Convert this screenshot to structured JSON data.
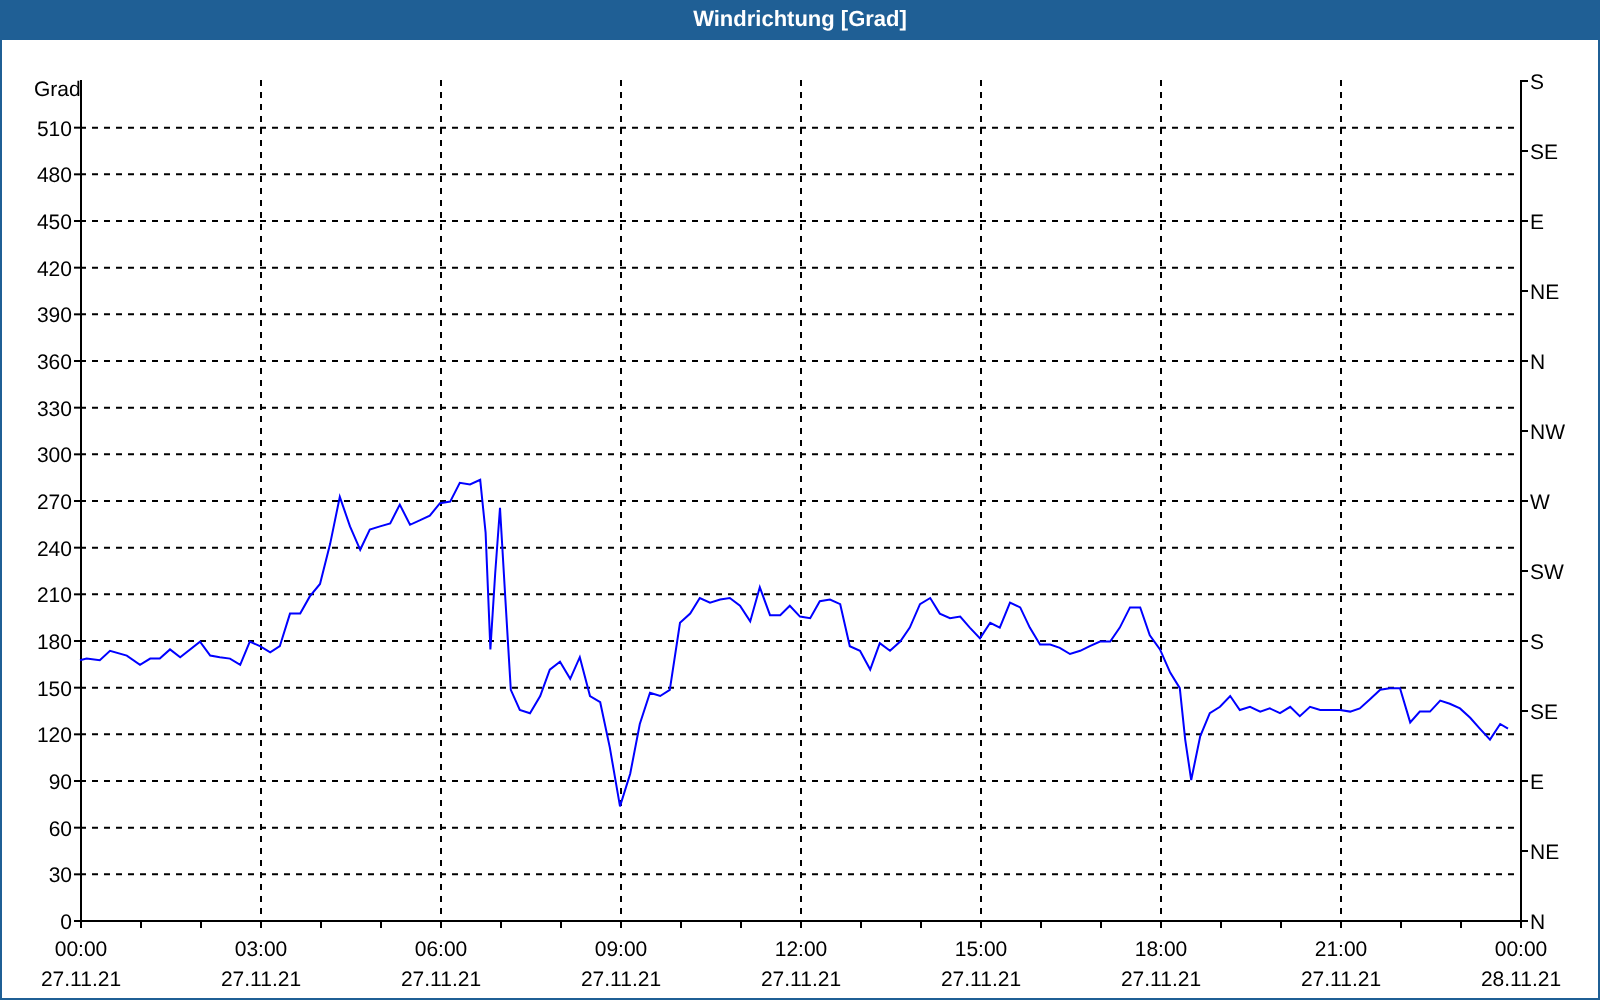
{
  "window": {
    "title": "Windrichtung [Grad]"
  },
  "chart": {
    "date_labels": [
      "27.11.21",
      "27.11.21",
      "27.11.21",
      "27.11.21",
      "27.11.21",
      "27.11.21",
      "27.11.21",
      "27.11.21",
      "28.11.21"
    ],
    "compass_labels": [
      "S",
      "SE",
      "E",
      "NE",
      "N",
      "NW",
      "W",
      "SW",
      "S",
      "SE",
      "E",
      "NE",
      "N"
    ],
    "chart_data": {
      "type": "line",
      "grid": true,
      "ylabel": "Grad",
      "xlim": [
        0,
        24
      ],
      "ylim": [
        0,
        540
      ],
      "yticks": [
        0,
        30,
        60,
        90,
        120,
        150,
        180,
        210,
        240,
        270,
        300,
        330,
        360,
        390,
        420,
        450,
        480,
        510
      ],
      "xticks": [
        {
          "value": 0,
          "label": "00:00"
        },
        {
          "value": 3,
          "label": "03:00"
        },
        {
          "value": 6,
          "label": "06:00"
        },
        {
          "value": 9,
          "label": "09:00"
        },
        {
          "value": 12,
          "label": "12:00"
        },
        {
          "value": 15,
          "label": "15:00"
        },
        {
          "value": 18,
          "label": "18:00"
        },
        {
          "value": 21,
          "label": "21:00"
        },
        {
          "value": 24,
          "label": "00:00"
        }
      ],
      "x": [
        0,
        0.11,
        0.33,
        0.5,
        0.78,
        1.0,
        1.17,
        1.33,
        1.5,
        1.67,
        2.0,
        2.17,
        2.33,
        2.5,
        2.67,
        2.83,
        3.0,
        3.17,
        3.33,
        3.5,
        3.67,
        3.83,
        4.0,
        4.17,
        4.33,
        4.5,
        4.67,
        4.83,
        5.0,
        5.17,
        5.33,
        5.5,
        5.67,
        5.83,
        6.0,
        6.17,
        6.33,
        6.5,
        6.67,
        6.76,
        6.84,
        6.92,
        7.0,
        7.09,
        7.18,
        7.33,
        7.5,
        7.67,
        7.83,
        8.0,
        8.17,
        8.33,
        8.5,
        8.67,
        8.83,
        9.0,
        9.17,
        9.33,
        9.5,
        9.67,
        9.83,
        10.0,
        10.17,
        10.33,
        10.5,
        10.67,
        10.83,
        11.0,
        11.17,
        11.33,
        11.5,
        11.67,
        11.83,
        12.0,
        12.17,
        12.33,
        12.5,
        12.67,
        12.83,
        13.0,
        13.17,
        13.33,
        13.5,
        13.67,
        13.83,
        14.0,
        14.17,
        14.33,
        14.5,
        14.67,
        14.83,
        15.0,
        15.17,
        15.33,
        15.5,
        15.67,
        15.83,
        16.0,
        16.17,
        16.33,
        16.5,
        16.67,
        16.83,
        17.0,
        17.17,
        17.33,
        17.5,
        17.67,
        17.83,
        18.0,
        18.17,
        18.33,
        18.42,
        18.52,
        18.67,
        18.83,
        19.0,
        19.17,
        19.33,
        19.5,
        19.67,
        19.83,
        20.0,
        20.17,
        20.33,
        20.5,
        20.67,
        20.83,
        21.0,
        21.17,
        21.33,
        21.5,
        21.67,
        21.83,
        22.0,
        22.17,
        22.33,
        22.5,
        22.67,
        22.83,
        23.0,
        23.17,
        23.33,
        23.5,
        23.67,
        23.8
      ],
      "series": [
        {
          "color": "#0000ff",
          "values": [
            167,
            168,
            167,
            173,
            170,
            164,
            168,
            168,
            174,
            169,
            179,
            170,
            169,
            168,
            164,
            179,
            176,
            172,
            176,
            197,
            197,
            208,
            216,
            242,
            272,
            253,
            238,
            251,
            253,
            255,
            267,
            254,
            257,
            260,
            268,
            269,
            281,
            280,
            283,
            249,
            174,
            223,
            265,
            206,
            148,
            135,
            133,
            144,
            161,
            166,
            155,
            169,
            144,
            140,
            111,
            73,
            94,
            126,
            146,
            144,
            148,
            191,
            197,
            207,
            204,
            206,
            207,
            202,
            192,
            214,
            196,
            196,
            202,
            195,
            194,
            205,
            206,
            203,
            176,
            173,
            161,
            178,
            173,
            179,
            188,
            203,
            207,
            197,
            194,
            195,
            188,
            181,
            191,
            188,
            204,
            201,
            188,
            177,
            177,
            175,
            171,
            173,
            176,
            179,
            179,
            188,
            201,
            201,
            183,
            174,
            159,
            149,
            116,
            90,
            118,
            133,
            137,
            144,
            135,
            137,
            134,
            136,
            133,
            137,
            131,
            137,
            135,
            135,
            135,
            134,
            136,
            142,
            148,
            149,
            149,
            127,
            134,
            134,
            141,
            139,
            136,
            130,
            123,
            116,
            126,
            123
          ]
        }
      ]
    }
  }
}
